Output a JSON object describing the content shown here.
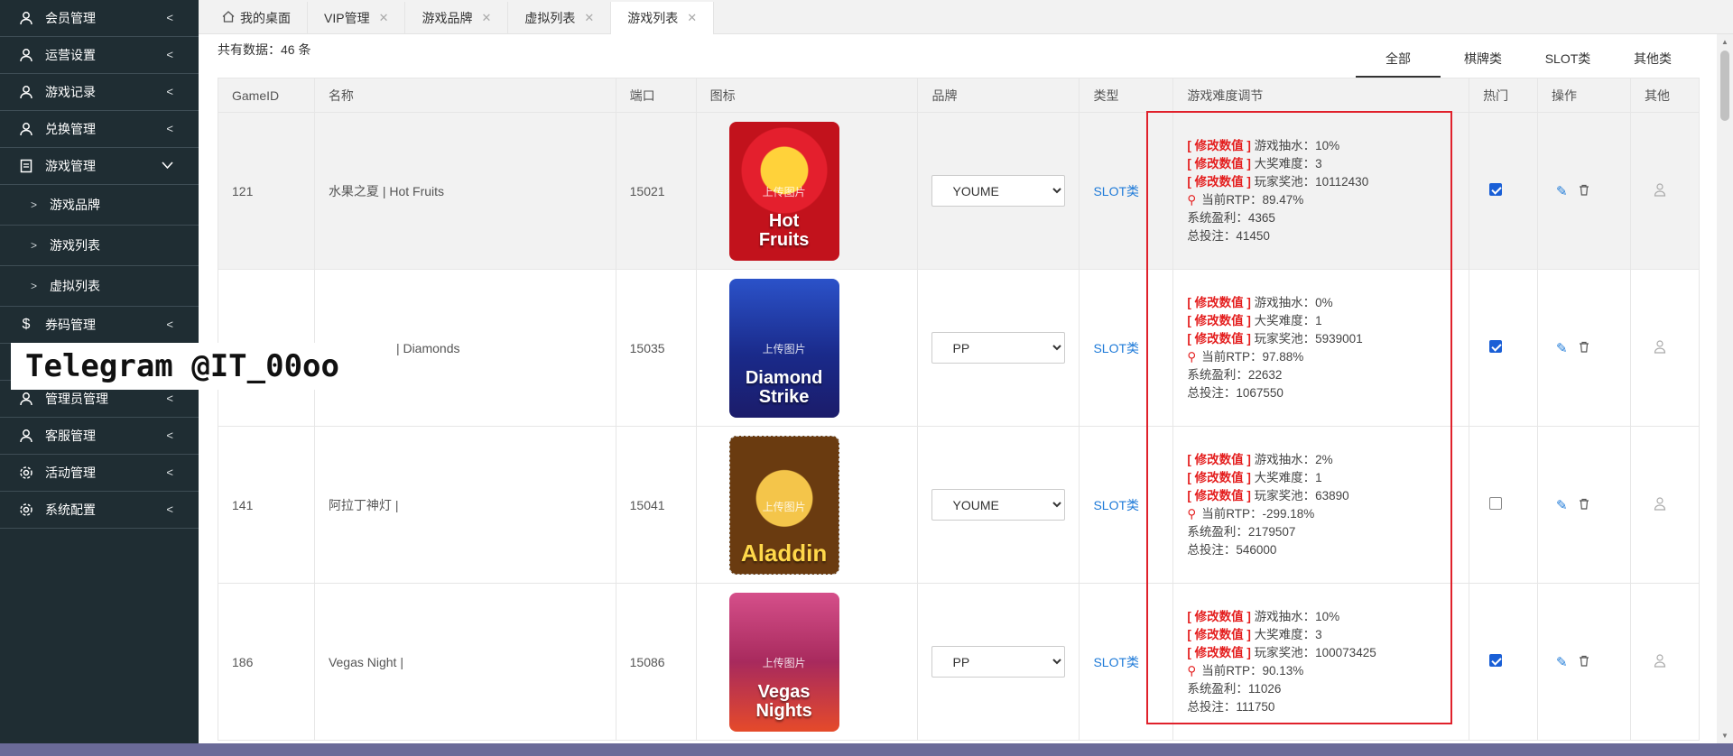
{
  "sidebar": {
    "items": [
      {
        "label": "会员管理",
        "icon": "user-icon"
      },
      {
        "label": "运营设置",
        "icon": "user-icon"
      },
      {
        "label": "游戏记录",
        "icon": "user-icon"
      },
      {
        "label": "兑换管理",
        "icon": "user-icon"
      },
      {
        "label": "游戏管理",
        "icon": "document-icon"
      },
      {
        "label": "游戏品牌"
      },
      {
        "label": "游戏列表"
      },
      {
        "label": "虚拟列表"
      },
      {
        "label": "券码管理",
        "icon": "dollar-icon"
      },
      {
        "label": "管理员管理",
        "icon": "user-icon"
      },
      {
        "label": "客服管理",
        "icon": "user-icon"
      },
      {
        "label": "活动管理",
        "icon": "gear-icon"
      },
      {
        "label": "系统配置",
        "icon": "gear-icon"
      }
    ]
  },
  "watermark": "Telegram @IT_00oo",
  "tabs": [
    {
      "label": "我的桌面"
    },
    {
      "label": "VIP管理"
    },
    {
      "label": "游戏品牌"
    },
    {
      "label": "虚拟列表"
    },
    {
      "label": "游戏列表"
    }
  ],
  "count_text": "共有数据：46 条",
  "filters": [
    "全部",
    "棋牌类",
    "SLOT类",
    "其他类"
  ],
  "table": {
    "headers": [
      "GameID",
      "名称",
      "端口",
      "图标",
      "品牌",
      "类型",
      "游戏难度调节",
      "热门",
      "操作",
      "其他"
    ],
    "upload_label": "上传图片",
    "edit_label": "[ 修改数值 ]",
    "rows": [
      {
        "id": "121",
        "name": "水果之夏 | Hot Fruits",
        "port": "15021",
        "thumb_line1": "Hot",
        "thumb_line2": "Fruits",
        "brand": "YOUME",
        "type": "SLOT类",
        "rake": "游戏抽水：10%",
        "difficulty": "大奖难度：3",
        "pool": "玩家奖池：10112430",
        "rtp": "当前RTP：89.47%",
        "profit": "系统盈利：4365",
        "bet": "总投注：41450",
        "hot": true
      },
      {
        "id": "",
        "name": "| Diamonds",
        "port": "15035",
        "thumb_line1": "Diamond",
        "thumb_line2": "Strike",
        "brand": "PP",
        "type": "SLOT类",
        "rake": "游戏抽水：0%",
        "difficulty": "大奖难度：1",
        "pool": "玩家奖池：5939001",
        "rtp": "当前RTP：97.88%",
        "profit": "系统盈利：22632",
        "bet": "总投注：1067550",
        "hot": true
      },
      {
        "id": "141",
        "name": "阿拉丁神灯 |",
        "port": "15041",
        "thumb_line1": "Aladdin",
        "thumb_line2": "",
        "brand": "YOUME",
        "type": "SLOT类",
        "rake": "游戏抽水：2%",
        "difficulty": "大奖难度：1",
        "pool": "玩家奖池：63890",
        "rtp": "当前RTP：-299.18%",
        "profit": "系统盈利：2179507",
        "bet": "总投注：546000",
        "hot": false
      },
      {
        "id": "186",
        "name": "Vegas Night |",
        "port": "15086",
        "thumb_line1": "Vegas",
        "thumb_line2": "Nights",
        "brand": "PP",
        "type": "SLOT类",
        "rake": "游戏抽水：10%",
        "difficulty": "大奖难度：3",
        "pool": "玩家奖池：100073425",
        "rtp": "当前RTP：90.13%",
        "profit": "系统盈利：11026",
        "bet": "总投注：111750",
        "hot": true
      }
    ]
  },
  "brand_options": [
    "YOUME",
    "PP"
  ],
  "colors": {
    "sidebar": "#1f2d33",
    "accent_red": "#e41e1e",
    "link_blue": "#1e7ad8",
    "topbar": "#6a6a98"
  }
}
